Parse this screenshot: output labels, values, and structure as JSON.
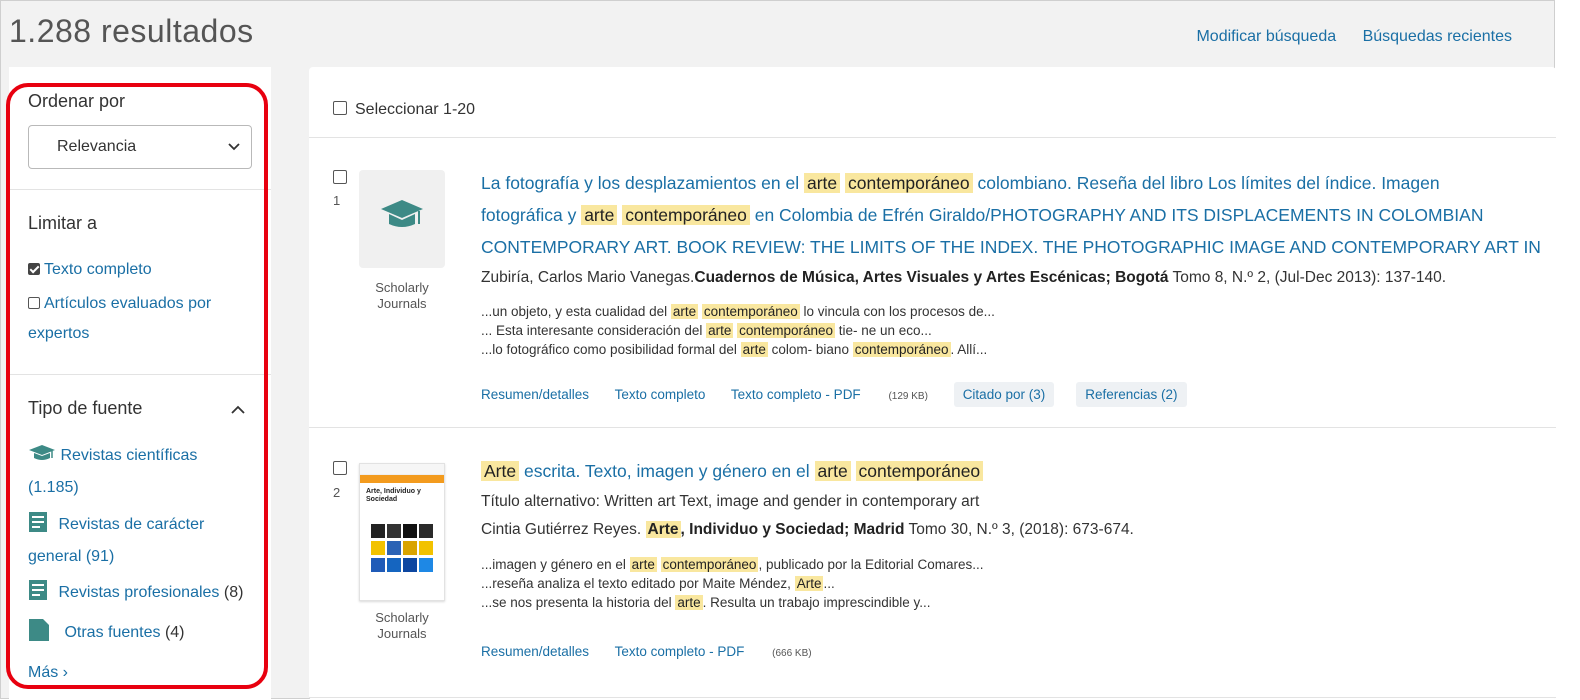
{
  "header": {
    "results_count": "1.288 resultados",
    "modify_search": "Modificar búsqueda",
    "recent_searches": "Búsquedas recientes"
  },
  "sidebar": {
    "sort_heading": "Ordenar por",
    "sort_value": "Relevancia",
    "limit_heading": "Limitar a",
    "limit_full_text": "Texto completo",
    "limit_peer_reviewed_1": "Artículos evaluados por",
    "limit_peer_reviewed_2": "expertos",
    "source_heading": "Tipo de fuente",
    "sources": [
      {
        "label": "Revistas científicas",
        "count": "(1.185)"
      },
      {
        "label_1": "Revistas de carácter",
        "label_2": "general",
        "count": "(91)"
      },
      {
        "label": "Revistas profesionales",
        "count": "(8)"
      },
      {
        "label": "Otras fuentes",
        "count": "(4)"
      }
    ],
    "more": "Más ›"
  },
  "main": {
    "select_all": "Seleccionar 1-20",
    "results": [
      {
        "number": "1",
        "type_1": "Scholarly",
        "type_2": "Journals",
        "title_a": "La fotografía y los desplazamientos en el ",
        "title_hl1": "arte",
        "title_hl2": "contemporáneo",
        "title_b": " colombiano. Reseña del libro Los límites del índice. Imagen",
        "title_c": "fotográfica y ",
        "title_hl3": "arte",
        "title_hl4": "contemporáneo",
        "title_d": " en Colombia de Efrén Giraldo/PHOTOGRAPHY AND ITS DISPLACEMENTS IN COLOMBIAN",
        "title_e": "CONTEMPORARY ART. BOOK REVIEW: THE LIMITS OF THE INDEX. THE PHOTOGRAPHIC IMAGE AND CONTEMPORARY ART IN",
        "author": "Zubiría, Carlos Mario Vanegas.",
        "source": "Cuadernos de Música, Artes Visuales y Artes Escénicas; Bogotá",
        "details": " Tomo 8, N.º 2,  (Jul-Dec 2013): 137-140.",
        "snip1_a": "...un objeto, y esta cualidad del ",
        "snip1_b": " lo vincula con los procesos de...",
        "snip2_a": "... Esta interesante consideración del ",
        "snip2_b": " tie- ne un eco...",
        "snip3_a": "...lo fotográfico como posibilidad formal del ",
        "snip3_b": " colom- biano ",
        "snip3_c": ". Allí...",
        "w_arte": "arte",
        "w_contemporaneo": "contemporáneo",
        "link_abstract": "Resumen/detalles",
        "link_fulltext": "Texto completo",
        "link_pdf": "Texto completo - PDF",
        "pdf_size": "(129 KB)",
        "link_cited": "Citado por (3)",
        "link_refs": "Referencias (2)"
      },
      {
        "number": "2",
        "type_1": "Scholarly",
        "type_2": "Journals",
        "cover_title": "Arte, Individuo y Sociedad",
        "title_hl1": "Arte",
        "title_a": " escrita. Texto, imagen y género en el ",
        "title_hl2": "arte",
        "title_hl3": "contemporáneo",
        "alt_title": "Título alternativo: Written art Text, image and gender in contemporary art",
        "author": "Cintia Gutiérrez Reyes. ",
        "source_hl": "Arte",
        "source": ", Individuo y Sociedad; Madrid",
        "details": " Tomo 30, N.º 3,  (2018): 673-674.",
        "snip1_a": "...imagen y género en el ",
        "snip1_b": ", publicado por la Editorial Comares...",
        "snip2_a": "...reseña analiza el texto editado por Maite Méndez, ",
        "snip2_b": "...",
        "snip3_a": "...se nos presenta la historia del ",
        "snip3_b": ". Resulta un trabajo imprescindible y...",
        "w_arte": "arte",
        "w_Arte": "Arte",
        "w_contemporaneo": "contemporáneo",
        "link_abstract": "Resumen/detalles",
        "link_pdf": "Texto completo - PDF",
        "pdf_size": "(666 KB)"
      }
    ]
  },
  "colors": {
    "link": "#1a6fa5",
    "highlight": "#f9e79f",
    "annotation_frame": "#e8000f",
    "journal_icon": "#3d8a86"
  }
}
